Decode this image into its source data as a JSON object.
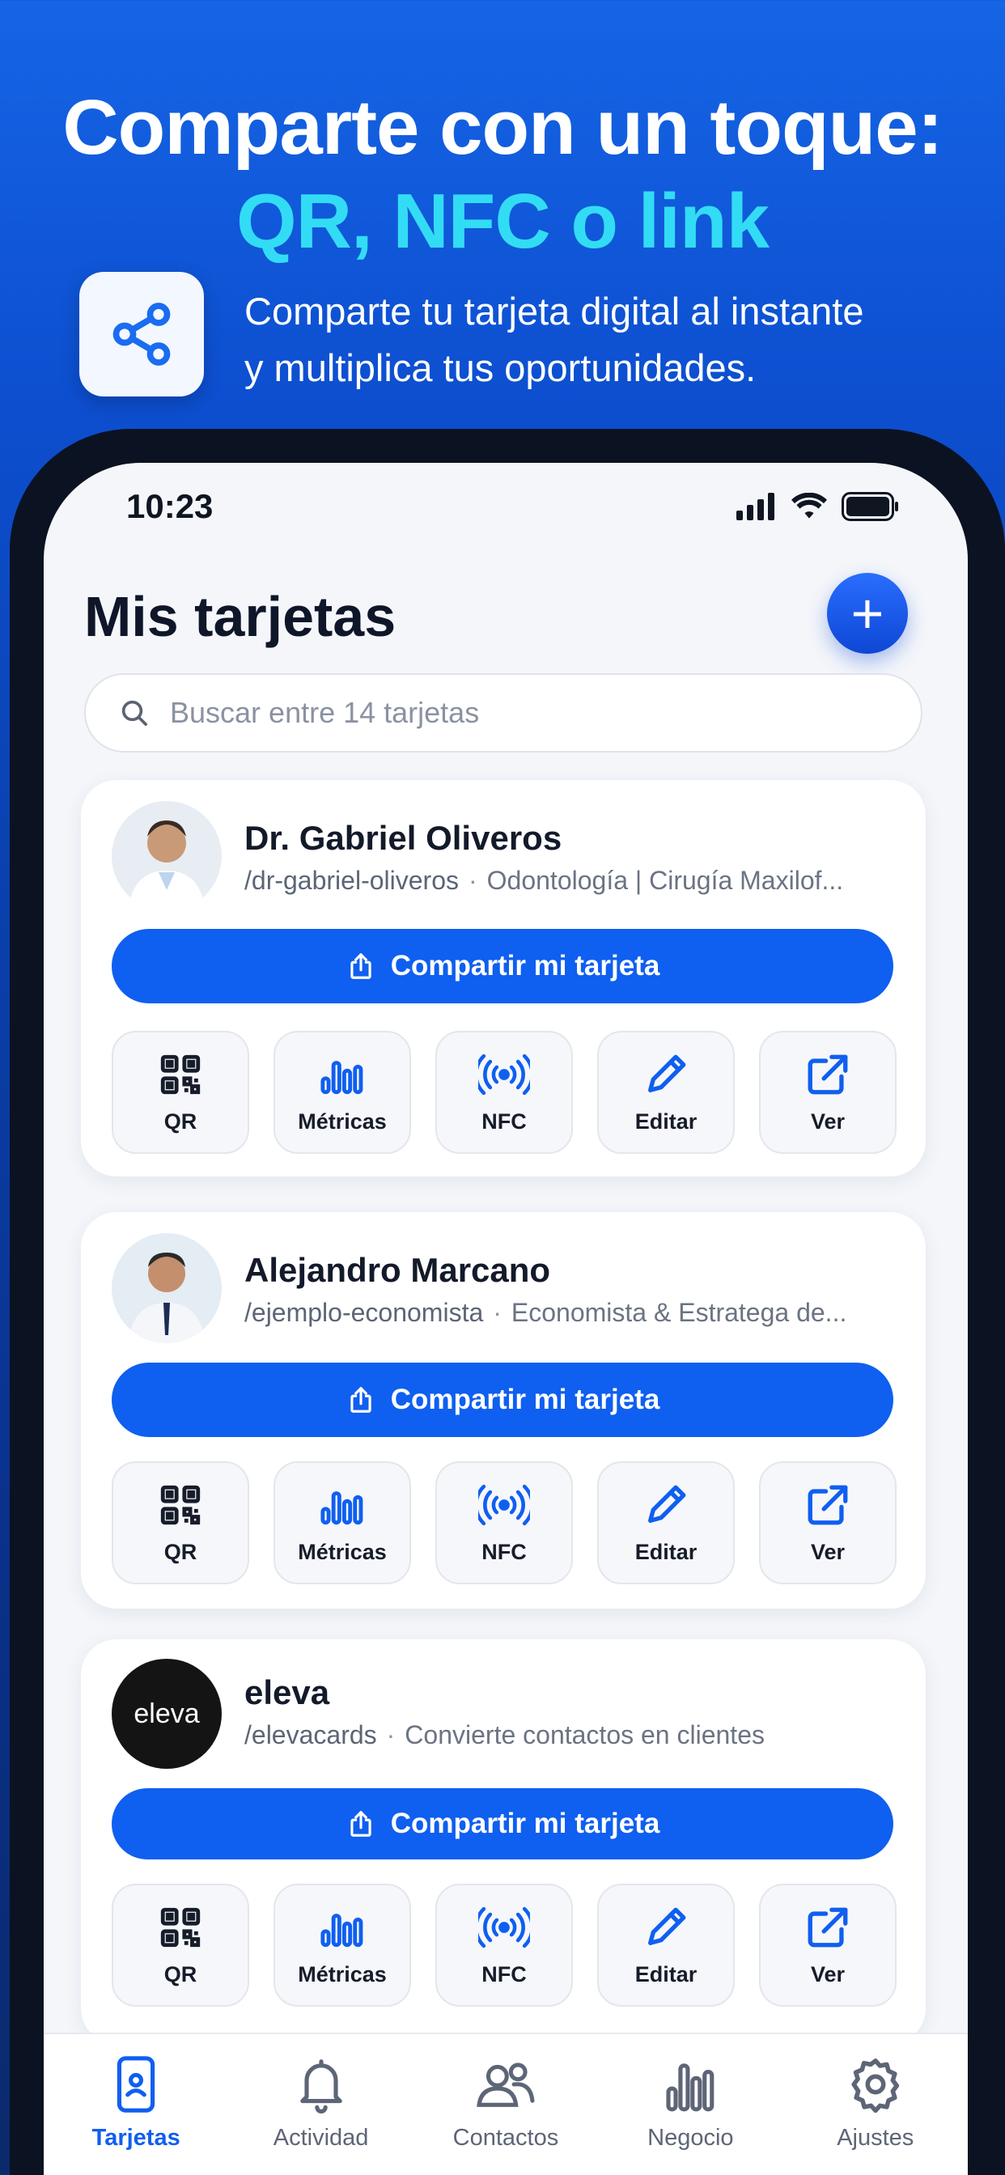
{
  "promo": {
    "headline_line1": "Comparte con un toque:",
    "headline_line2": "QR, NFC o link",
    "subtitle_line1": "Comparte tu tarjeta digital al instante",
    "subtitle_line2": "y multiplica tus oportunidades.",
    "icon": "share-nodes-icon"
  },
  "status_bar": {
    "time": "10:23"
  },
  "header": {
    "title": "Mis tarjetas",
    "add_label": "+"
  },
  "search": {
    "placeholder": "Buscar entre 14 tarjetas"
  },
  "cards": [
    {
      "name": "Dr. Gabriel Oliveros",
      "slug": "/dr-gabriel-oliveros",
      "separator": "·",
      "description": "Odontología | Cirugía Maxilof...",
      "share_label": "Compartir mi tarjeta"
    },
    {
      "name": "Alejandro Marcano",
      "slug": "/ejemplo-economista",
      "separator": "·",
      "description": "Economista & Estratega de...",
      "share_label": "Compartir mi tarjeta"
    },
    {
      "name": "eleva",
      "slug": "/elevacards",
      "separator": "·",
      "description": "Convierte contactos en clientes",
      "share_label": "Compartir mi tarjeta",
      "logo_text": "eleva"
    }
  ],
  "actions": [
    {
      "label": "QR",
      "icon": "qr-icon"
    },
    {
      "label": "Métricas",
      "icon": "metrics-icon"
    },
    {
      "label": "NFC",
      "icon": "nfc-icon"
    },
    {
      "label": "Editar",
      "icon": "edit-icon"
    },
    {
      "label": "Ver",
      "icon": "external-link-icon"
    }
  ],
  "tabbar": [
    {
      "label": "Tarjetas",
      "icon": "phone-card-icon",
      "active": true
    },
    {
      "label": "Actividad",
      "icon": "bell-icon"
    },
    {
      "label": "Contactos",
      "icon": "contacts-icon"
    },
    {
      "label": "Negocio",
      "icon": "bar-chart-icon"
    },
    {
      "label": "Ajustes",
      "icon": "gear-icon"
    }
  ],
  "colors": {
    "accent": "#0f5ff0",
    "headline_accent": "#33dcf5",
    "background": "#0d4fd0"
  }
}
